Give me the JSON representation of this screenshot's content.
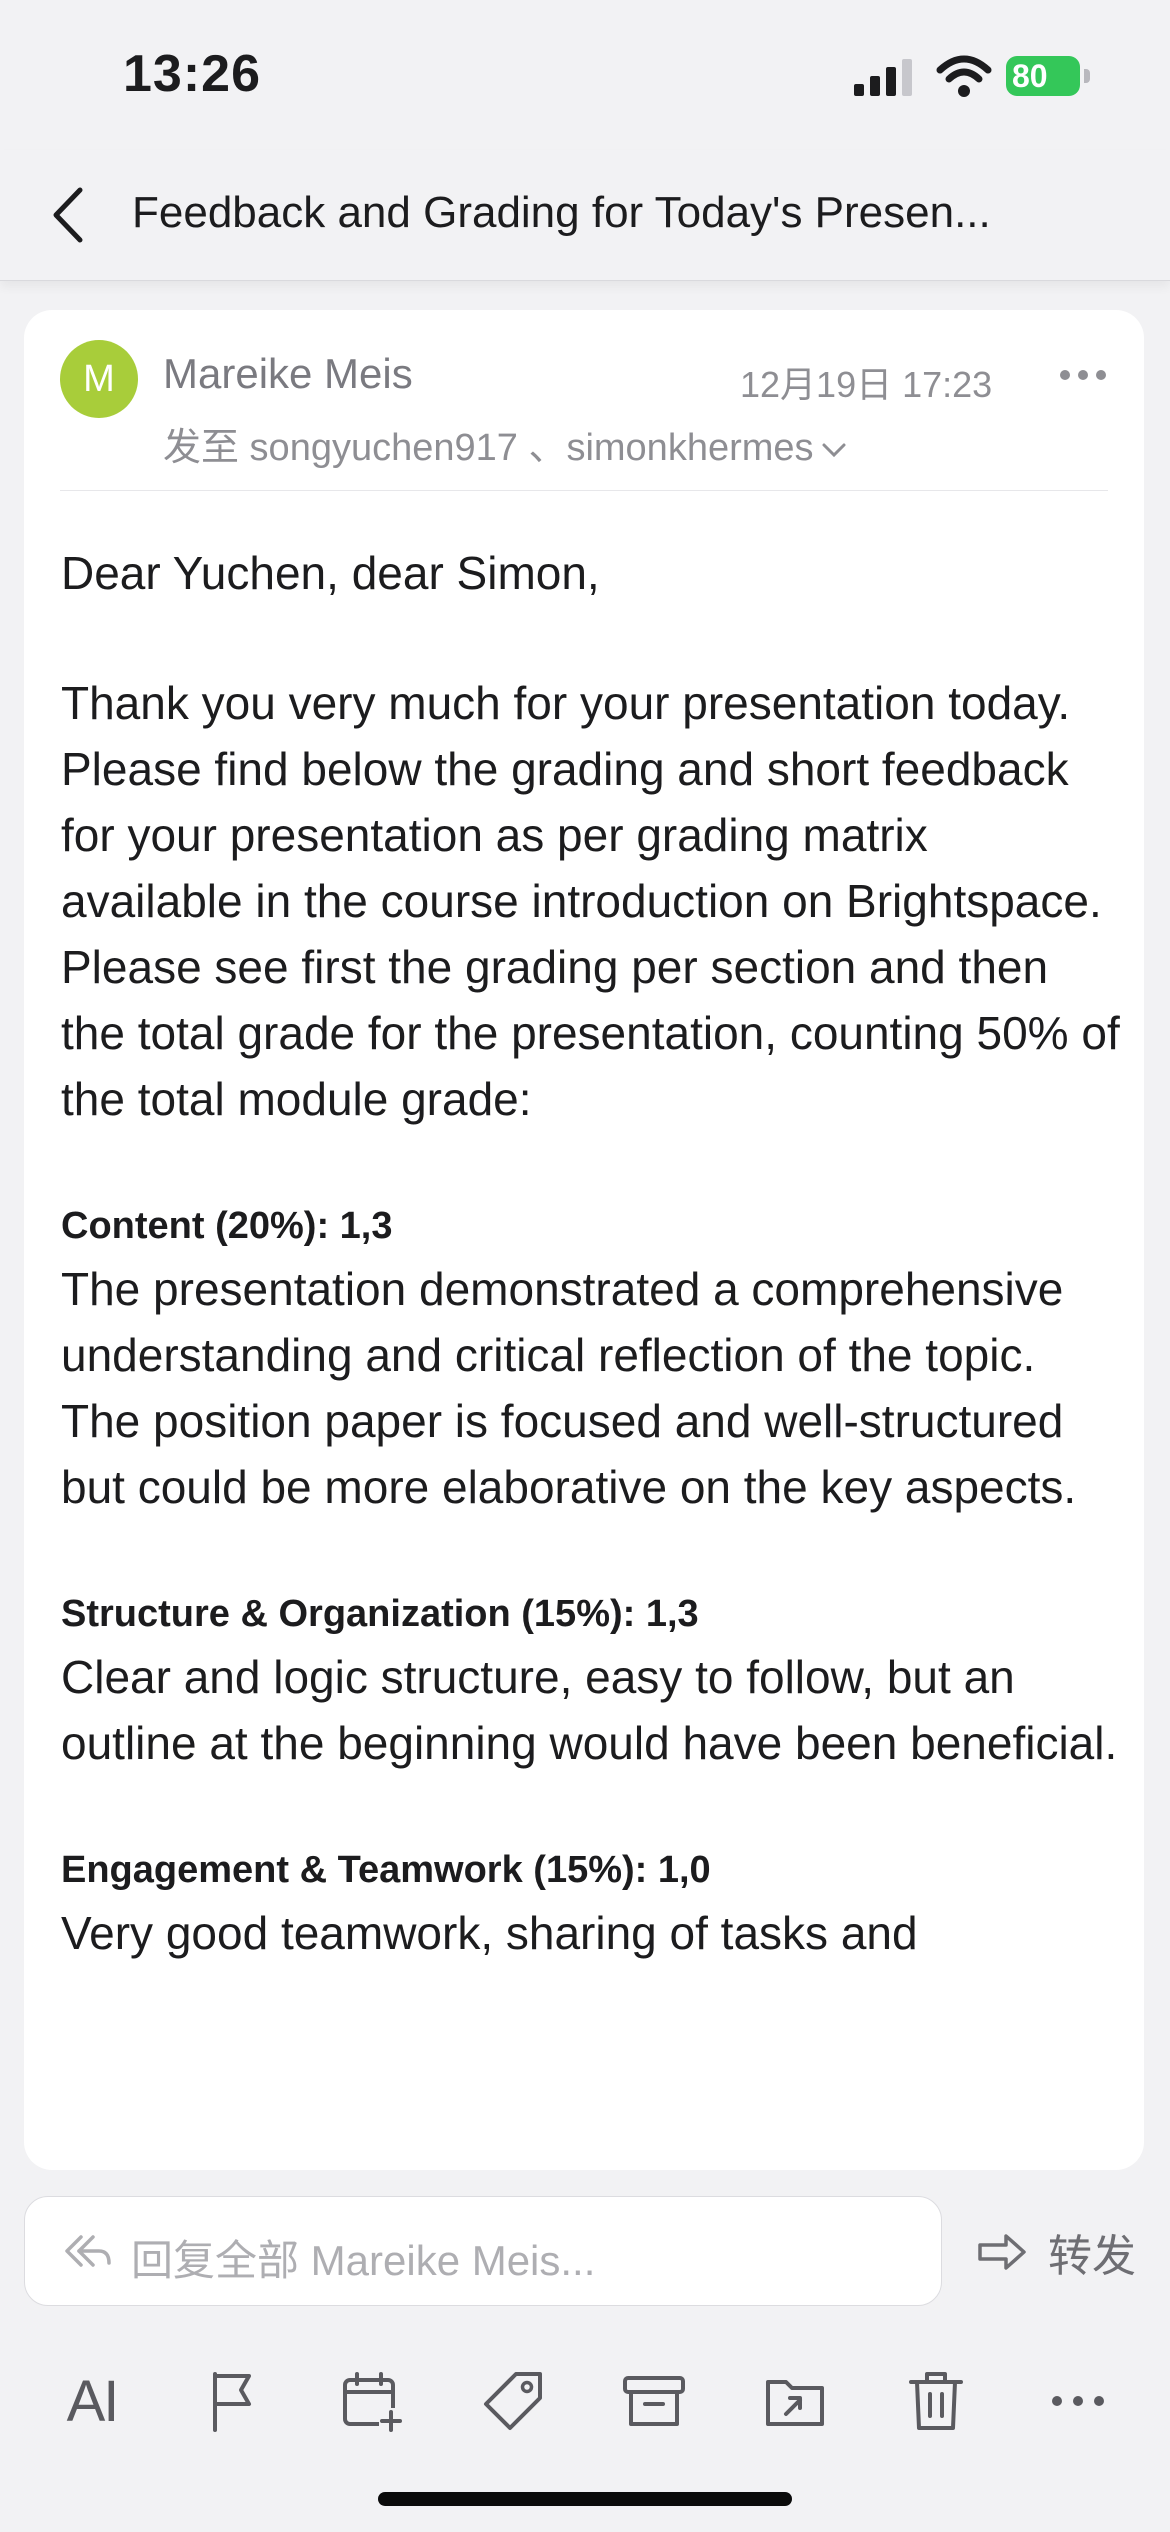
{
  "status": {
    "time": "13:26",
    "battery": "80"
  },
  "nav": {
    "title": "Feedback and Grading for Today's Presen..."
  },
  "mail": {
    "avatar_letter": "M",
    "sender": "Mareike Meis",
    "date": "12月19日 17:23",
    "recipients": "发至 songyuchen917 、simonkhermes",
    "greeting": "Dear Yuchen, dear Simon,",
    "intro": "Thank you very much for your presentation today. Please find below the grading and short feedback for your presentation as per grading matrix available in the course introduction on Brightspace. Please see first the grading per section and then the total grade for the presentation, counting 50% of the total module grade:",
    "sections": [
      {
        "heading": "Content (20%): 1,3",
        "text": "The presentation demonstrated a comprehensive understanding and critical reflection of the topic. The position paper is focused and well-structured but could be more elaborative on the key aspects."
      },
      {
        "heading": "Structure & Organization (15%): 1,3",
        "text": "Clear and logic structure, easy to follow, but an outline at the beginning would have been beneficial."
      },
      {
        "heading": "Engagement & Teamwork (15%): 1,0",
        "text": "Very good teamwork, sharing of tasks and"
      }
    ]
  },
  "reply": {
    "placeholder": "回复全部  Mareike Meis...",
    "forward_label": "转发"
  },
  "toolbar": {
    "ai_label": "AI"
  },
  "icons": [
    "back-chevron-icon",
    "more-icon",
    "chevron-down-icon",
    "reply-all-icon",
    "forward-icon",
    "flag-icon",
    "calendar-add-icon",
    "tag-icon",
    "archive-icon",
    "move-folder-icon",
    "trash-icon"
  ]
}
